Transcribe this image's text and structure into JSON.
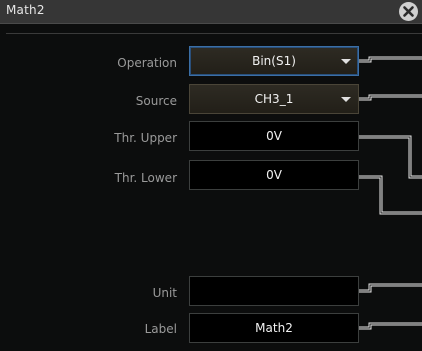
{
  "window": {
    "title": "Math2"
  },
  "fields": {
    "operation": {
      "label": "Operation",
      "value": "Bin(S1)"
    },
    "source": {
      "label": "Source",
      "value": "CH3_1"
    },
    "thr_upper": {
      "label": "Thr. Upper",
      "value": "0V"
    },
    "thr_lower": {
      "label": "Thr. Lower",
      "value": "0V"
    },
    "unit": {
      "label": "Unit",
      "value": ""
    },
    "label": {
      "label": "Label",
      "value": "Math2"
    }
  },
  "icons": {
    "close": "close-icon",
    "dropdown": "chevron-down-icon"
  },
  "colors": {
    "background": "#0c0d0d",
    "titlebar": "#363636",
    "focus_border": "#3b6fa6",
    "label_text": "#9a9a9a"
  }
}
